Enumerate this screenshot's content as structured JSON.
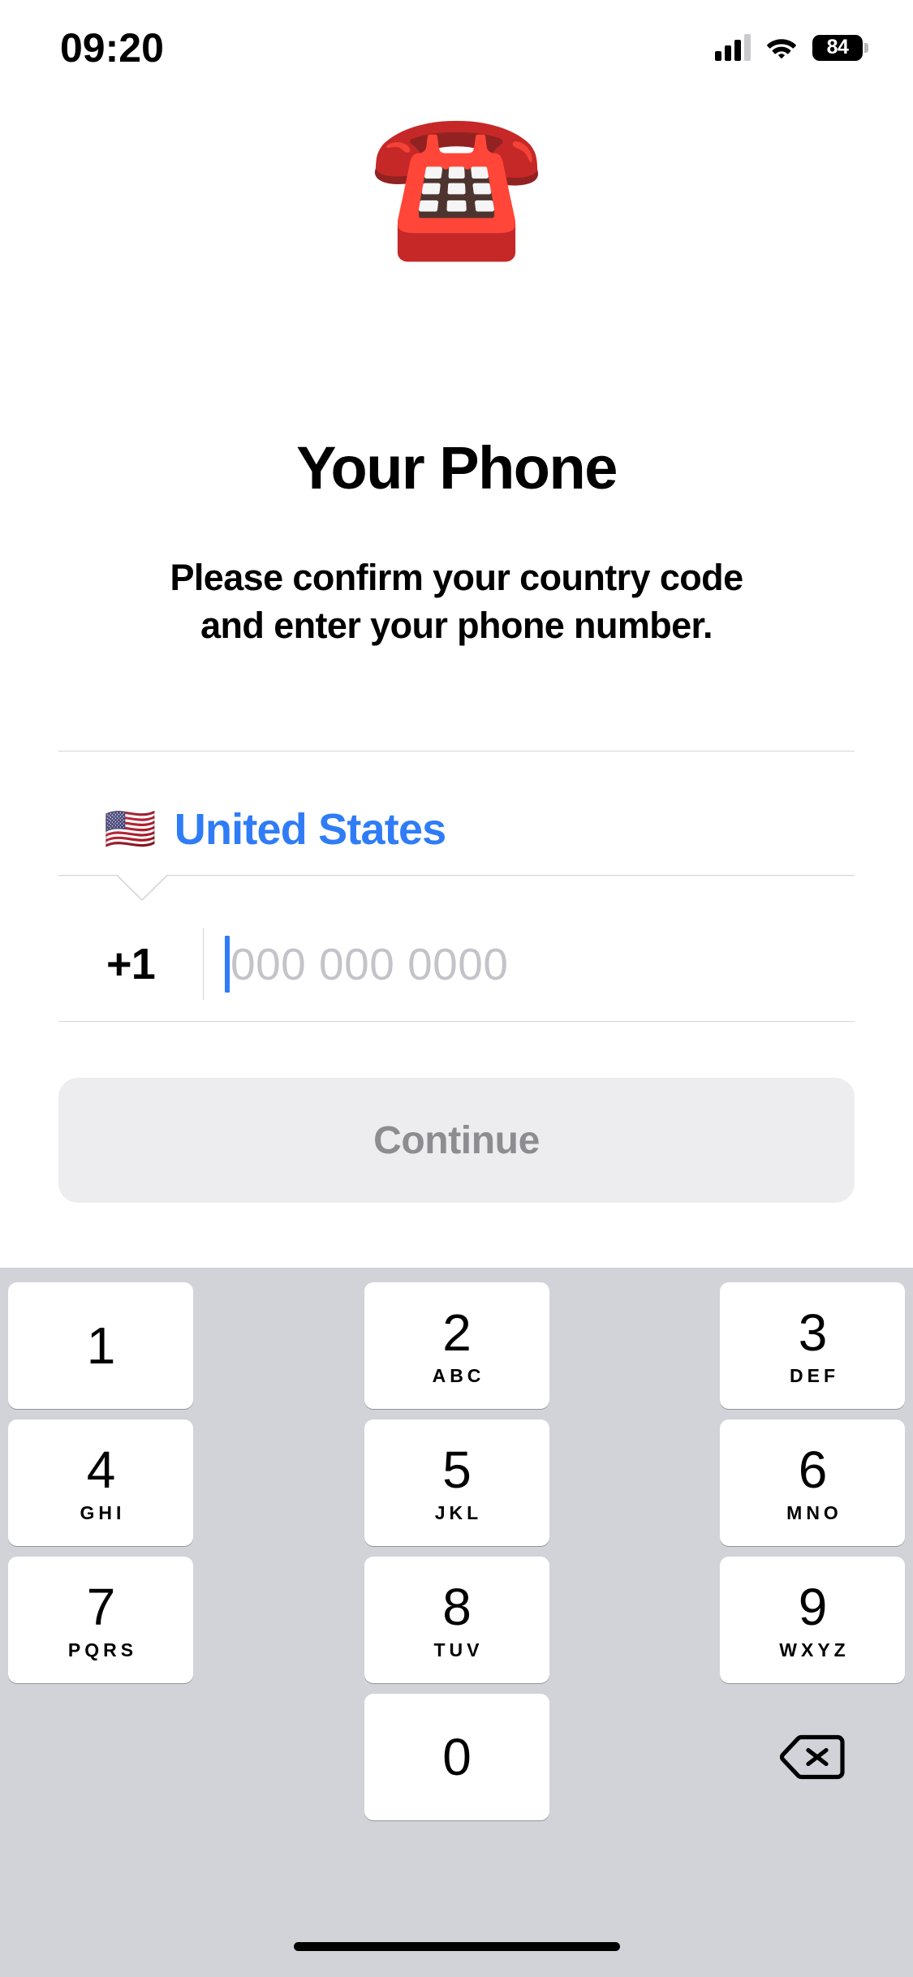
{
  "status_bar": {
    "time": "09:20",
    "signal_icon": "cellular-bars-icon",
    "wifi_icon": "wifi-icon",
    "battery_level": "84",
    "battery_icon": "battery-icon"
  },
  "hero": {
    "emoji": "☎️",
    "emoji_name": "telephone-emoji",
    "title": "Your Phone",
    "subtitle_line1": "Please confirm your country code",
    "subtitle_line2": "and enter your phone number."
  },
  "form": {
    "country": {
      "flag": "🇺🇸",
      "flag_name": "flag-united-states",
      "name": "United States"
    },
    "dial_code": "+1",
    "phone_value": "",
    "phone_placeholder": "000 000 0000",
    "continue_label": "Continue"
  },
  "colors": {
    "accent_blue": "#2F7CF6",
    "placeholder_gray": "#C3C3C9",
    "divider_gray": "#D6D6DA",
    "button_bg": "#EDEDEF",
    "button_text": "#8C8C91",
    "keyboard_bg": "#D1D3D9",
    "key_bg": "#FFFFFF"
  },
  "keypad": {
    "rows": [
      [
        {
          "digit": "1",
          "letters": ""
        },
        {
          "digit": "2",
          "letters": "ABC"
        },
        {
          "digit": "3",
          "letters": "DEF"
        }
      ],
      [
        {
          "digit": "4",
          "letters": "GHI"
        },
        {
          "digit": "5",
          "letters": "JKL"
        },
        {
          "digit": "6",
          "letters": "MNO"
        }
      ],
      [
        {
          "digit": "7",
          "letters": "PQRS"
        },
        {
          "digit": "8",
          "letters": "TUV"
        },
        {
          "digit": "9",
          "letters": "WXYZ"
        }
      ],
      [
        {
          "digit": "",
          "letters": ""
        },
        {
          "digit": "0",
          "letters": ""
        },
        {
          "digit": "delete",
          "letters": ""
        }
      ]
    ],
    "delete_icon": "backspace-icon"
  }
}
